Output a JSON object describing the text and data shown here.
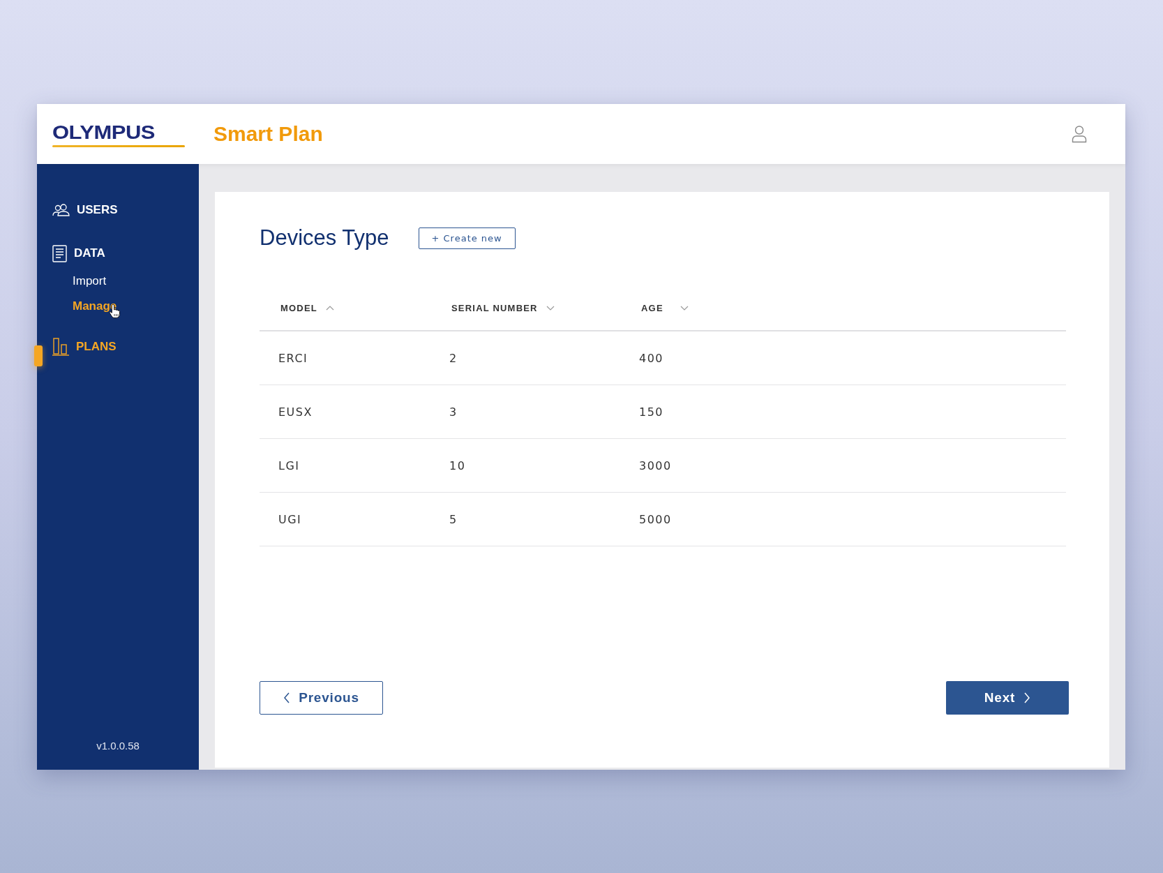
{
  "header": {
    "logo": "OLYMPUS",
    "app_title": "Smart Plan"
  },
  "sidebar": {
    "items": [
      {
        "label": "USERS",
        "selected": false
      },
      {
        "label": "DATA",
        "selected": false,
        "children": [
          {
            "label": "Import",
            "selected": false
          },
          {
            "label": "Manage",
            "selected": true
          }
        ]
      },
      {
        "label": "PLANS",
        "selected": true
      }
    ],
    "version": "v1.0.0.58"
  },
  "page": {
    "title": "Devices Type",
    "create_button": "+ Create new"
  },
  "table": {
    "columns": [
      {
        "label": "MODEL",
        "ascending": true
      },
      {
        "label": "SERIAL NUMBER",
        "ascending": false
      },
      {
        "label": "AGE",
        "ascending": false
      }
    ],
    "rows": [
      [
        "ERCI",
        "2",
        "400"
      ],
      [
        "EUSX",
        "3",
        "150"
      ],
      [
        "LGI",
        "10",
        "3000"
      ],
      [
        "UGI",
        "5",
        "5000"
      ]
    ]
  },
  "pagination": {
    "previous": "Previous",
    "next": "Next"
  }
}
